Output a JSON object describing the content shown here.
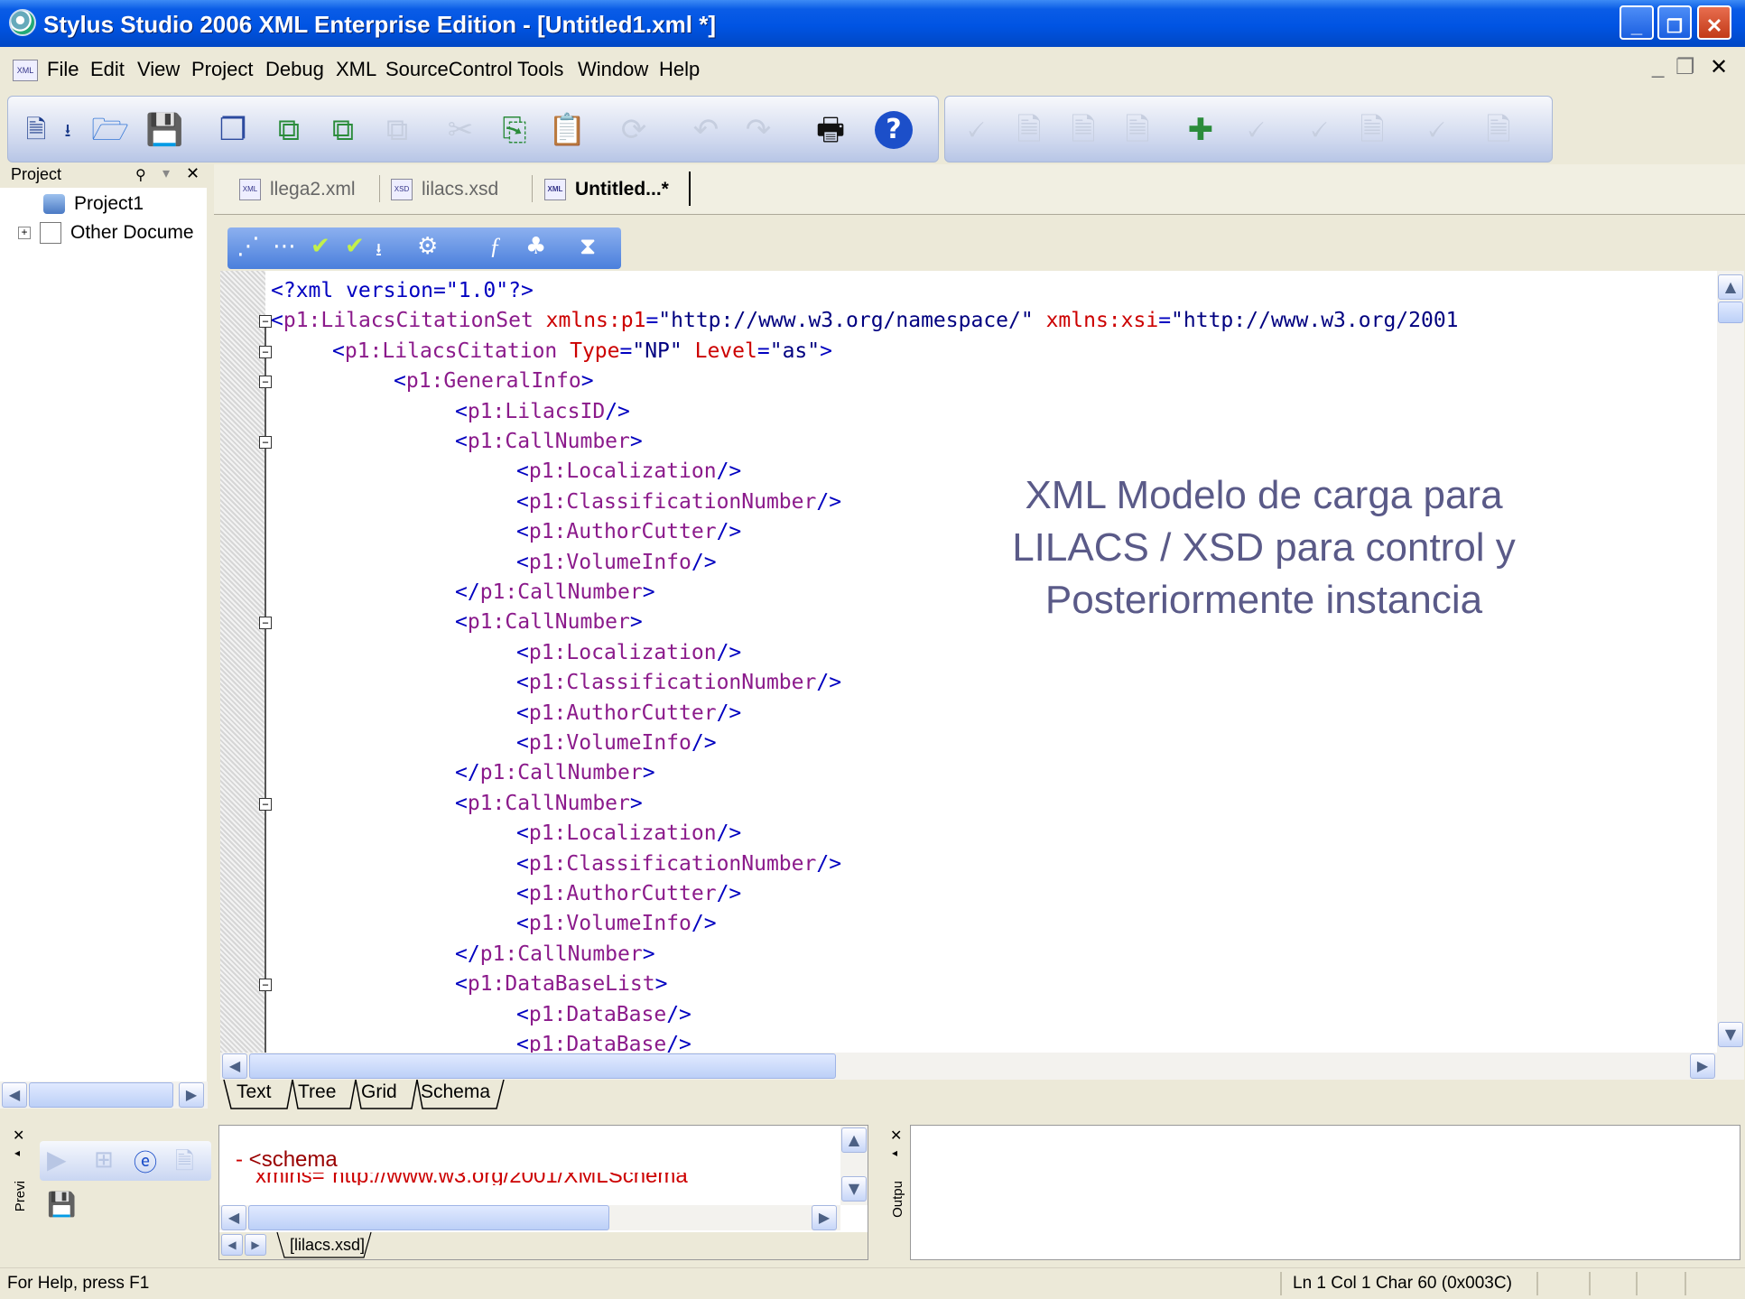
{
  "window": {
    "title": "Stylus Studio 2006 XML Enterprise Edition - [Untitled1.xml *]",
    "buttons": {
      "minimize": "_",
      "restore": "❐",
      "close": "✕"
    }
  },
  "menubar": {
    "icon_text": "XML",
    "items": [
      "File",
      "Edit",
      "View",
      "Project",
      "Debug",
      "XML",
      "SourceControl",
      "Tools",
      "Window",
      "Help"
    ],
    "mdi": {
      "minimize": "_",
      "restore": "❐",
      "close": "✕"
    }
  },
  "project_panel": {
    "title": "Project",
    "items": [
      {
        "label": "Project1"
      },
      {
        "label": "Other Docume"
      }
    ]
  },
  "editor_tabs": [
    {
      "label": "llega2.xml",
      "icon_text": "XML",
      "active": false
    },
    {
      "label": "lilacs.xsd",
      "icon_text": "XSD",
      "active": false
    },
    {
      "label": "Untitled...*",
      "icon_text": "XML",
      "active": true
    }
  ],
  "code_lines": [
    {
      "indent": 0,
      "parts": [
        [
          "pun",
          "<?xml version=\"1.0\"?>"
        ]
      ],
      "fold": ""
    },
    {
      "indent": 0,
      "parts": [
        [
          "pun",
          "<"
        ],
        [
          "tag",
          "p1:LilacsCitationSet "
        ],
        [
          "attr",
          "xmlns:p1"
        ],
        [
          "pun",
          "="
        ],
        [
          "val",
          "\"http://www.w3.org/namespace/\" "
        ],
        [
          "attr",
          "xmlns:xsi"
        ],
        [
          "pun",
          "="
        ],
        [
          "val",
          "\"http://www.w3.org/2001"
        ]
      ],
      "fold": "−"
    },
    {
      "indent": 1,
      "parts": [
        [
          "pun",
          "<"
        ],
        [
          "tag",
          "p1:LilacsCitation "
        ],
        [
          "attr",
          "Type"
        ],
        [
          "pun",
          "="
        ],
        [
          "val",
          "\"NP\" "
        ],
        [
          "attr",
          "Level"
        ],
        [
          "pun",
          "="
        ],
        [
          "val",
          "\"as\""
        ],
        [
          "pun",
          ">"
        ]
      ],
      "fold": "−"
    },
    {
      "indent": 2,
      "parts": [
        [
          "pun",
          "<"
        ],
        [
          "tag",
          "p1:GeneralInfo"
        ],
        [
          "pun",
          ">"
        ]
      ],
      "fold": "−"
    },
    {
      "indent": 3,
      "parts": [
        [
          "pun",
          "<"
        ],
        [
          "tag",
          "p1:LilacsID"
        ],
        [
          "pun",
          "/>"
        ]
      ],
      "fold": ""
    },
    {
      "indent": 3,
      "parts": [
        [
          "pun",
          "<"
        ],
        [
          "tag",
          "p1:CallNumber"
        ],
        [
          "pun",
          ">"
        ]
      ],
      "fold": "−"
    },
    {
      "indent": 4,
      "parts": [
        [
          "pun",
          "<"
        ],
        [
          "tag",
          "p1:Localization"
        ],
        [
          "pun",
          "/>"
        ]
      ],
      "fold": ""
    },
    {
      "indent": 4,
      "parts": [
        [
          "pun",
          "<"
        ],
        [
          "tag",
          "p1:ClassificationNumber"
        ],
        [
          "pun",
          "/>"
        ]
      ],
      "fold": ""
    },
    {
      "indent": 4,
      "parts": [
        [
          "pun",
          "<"
        ],
        [
          "tag",
          "p1:AuthorCutter"
        ],
        [
          "pun",
          "/>"
        ]
      ],
      "fold": ""
    },
    {
      "indent": 4,
      "parts": [
        [
          "pun",
          "<"
        ],
        [
          "tag",
          "p1:VolumeInfo"
        ],
        [
          "pun",
          "/>"
        ]
      ],
      "fold": ""
    },
    {
      "indent": 3,
      "parts": [
        [
          "pun",
          "</"
        ],
        [
          "tag",
          "p1:CallNumber"
        ],
        [
          "pun",
          ">"
        ]
      ],
      "fold": ""
    },
    {
      "indent": 3,
      "parts": [
        [
          "pun",
          "<"
        ],
        [
          "tag",
          "p1:CallNumber"
        ],
        [
          "pun",
          ">"
        ]
      ],
      "fold": "−"
    },
    {
      "indent": 4,
      "parts": [
        [
          "pun",
          "<"
        ],
        [
          "tag",
          "p1:Localization"
        ],
        [
          "pun",
          "/>"
        ]
      ],
      "fold": ""
    },
    {
      "indent": 4,
      "parts": [
        [
          "pun",
          "<"
        ],
        [
          "tag",
          "p1:ClassificationNumber"
        ],
        [
          "pun",
          "/>"
        ]
      ],
      "fold": ""
    },
    {
      "indent": 4,
      "parts": [
        [
          "pun",
          "<"
        ],
        [
          "tag",
          "p1:AuthorCutter"
        ],
        [
          "pun",
          "/>"
        ]
      ],
      "fold": ""
    },
    {
      "indent": 4,
      "parts": [
        [
          "pun",
          "<"
        ],
        [
          "tag",
          "p1:VolumeInfo"
        ],
        [
          "pun",
          "/>"
        ]
      ],
      "fold": ""
    },
    {
      "indent": 3,
      "parts": [
        [
          "pun",
          "</"
        ],
        [
          "tag",
          "p1:CallNumber"
        ],
        [
          "pun",
          ">"
        ]
      ],
      "fold": ""
    },
    {
      "indent": 3,
      "parts": [
        [
          "pun",
          "<"
        ],
        [
          "tag",
          "p1:CallNumber"
        ],
        [
          "pun",
          ">"
        ]
      ],
      "fold": "−"
    },
    {
      "indent": 4,
      "parts": [
        [
          "pun",
          "<"
        ],
        [
          "tag",
          "p1:Localization"
        ],
        [
          "pun",
          "/>"
        ]
      ],
      "fold": ""
    },
    {
      "indent": 4,
      "parts": [
        [
          "pun",
          "<"
        ],
        [
          "tag",
          "p1:ClassificationNumber"
        ],
        [
          "pun",
          "/>"
        ]
      ],
      "fold": ""
    },
    {
      "indent": 4,
      "parts": [
        [
          "pun",
          "<"
        ],
        [
          "tag",
          "p1:AuthorCutter"
        ],
        [
          "pun",
          "/>"
        ]
      ],
      "fold": ""
    },
    {
      "indent": 4,
      "parts": [
        [
          "pun",
          "<"
        ],
        [
          "tag",
          "p1:VolumeInfo"
        ],
        [
          "pun",
          "/>"
        ]
      ],
      "fold": ""
    },
    {
      "indent": 3,
      "parts": [
        [
          "pun",
          "</"
        ],
        [
          "tag",
          "p1:CallNumber"
        ],
        [
          "pun",
          ">"
        ]
      ],
      "fold": ""
    },
    {
      "indent": 3,
      "parts": [
        [
          "pun",
          "<"
        ],
        [
          "tag",
          "p1:DataBaseList"
        ],
        [
          "pun",
          ">"
        ]
      ],
      "fold": "−"
    },
    {
      "indent": 4,
      "parts": [
        [
          "pun",
          "<"
        ],
        [
          "tag",
          "p1:DataBase"
        ],
        [
          "pun",
          "/>"
        ]
      ],
      "fold": ""
    },
    {
      "indent": 4,
      "parts": [
        [
          "pun",
          "<"
        ],
        [
          "tag",
          "p1:DataBase"
        ],
        [
          "pun",
          "/>"
        ]
      ],
      "fold": ""
    }
  ],
  "overlay_text": {
    "line1": "XML Modelo de carga para",
    "line2": "LILACS / XSD para control  y",
    "line3": "Posteriormente instancia"
  },
  "view_tabs": [
    "Text",
    "Tree",
    "Grid",
    "Schema"
  ],
  "preview": {
    "label": "Previ",
    "text_dash": "-",
    "text_tag": "<schema",
    "text_partial": "xmlns=\"http://www.w3.org/2001/XMLSchema",
    "tab": "[lilacs.xsd]"
  },
  "output": {
    "label": "Outpu"
  },
  "statusbar": {
    "help": "For Help, press F1",
    "position": "Ln 1 Col 1  Char 60 (0x003C)"
  },
  "colors": {
    "titlebar": "#0054e3",
    "tag": "#8b1a8b",
    "attribute": "#cc0000",
    "value": "#000080",
    "overlay": "#5a5a88"
  }
}
